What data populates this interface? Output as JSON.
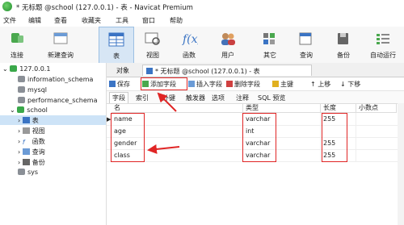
{
  "window": {
    "title": "* 无标题 @school (127.0.0.1) - 表 - Navicat Premium"
  },
  "menu": [
    "文件",
    "编辑",
    "查看",
    "收藏夹",
    "工具",
    "窗口",
    "帮助"
  ],
  "toolbar": {
    "connect": "连接",
    "new_query": "新建查询",
    "table": "表",
    "view": "视图",
    "function": "函数",
    "user": "用户",
    "other": "其它",
    "query": "查询",
    "backup": "备份",
    "automation": "自动运行"
  },
  "sidebar": {
    "connection": "127.0.0.1",
    "databases": [
      "information_schema",
      "mysql",
      "performance_schema"
    ],
    "open_db": "school",
    "children": [
      "表",
      "视图",
      "函数",
      "查询",
      "备份"
    ],
    "last_db": "sys"
  },
  "tabs": {
    "objects": "对象",
    "editor": "* 无标题 @school (127.0.0.1) - 表"
  },
  "actions": {
    "save": "保存",
    "add_field": "添加字段",
    "insert_field": "插入字段",
    "delete_field": "删除字段",
    "primary_key": "主键",
    "move_up": "上移",
    "move_down": "下移"
  },
  "subtabs": [
    "字段",
    "索引",
    "外键",
    "触发器",
    "选项",
    "注释",
    "SQL 预览"
  ],
  "columns": {
    "name": "名",
    "type": "类型",
    "length": "长度",
    "decimals": "小数点"
  },
  "fields": [
    {
      "name": "name",
      "type": "varchar",
      "length": "255"
    },
    {
      "name": "age",
      "type": "int",
      "length": ""
    },
    {
      "name": "gender",
      "type": "varchar",
      "length": "255"
    },
    {
      "name": "class",
      "type": "varchar",
      "length": "255"
    }
  ],
  "colors": {
    "highlight": "#e02525",
    "selection": "#cde3f7"
  }
}
